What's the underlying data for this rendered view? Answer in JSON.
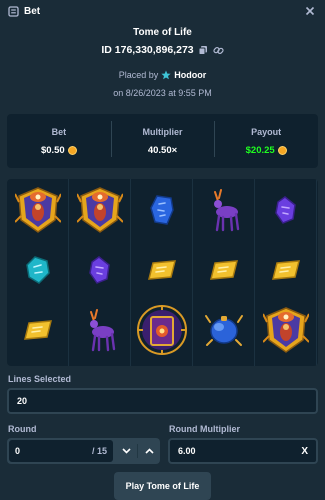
{
  "header": {
    "title": "Bet",
    "icon": "bet-slip-icon",
    "close_icon": "close-icon"
  },
  "bet": {
    "game": "Tome of Life",
    "id": "ID 176,330,896,273",
    "placed_by_label": "Placed by",
    "username": "Hodoor",
    "date": "on 8/26/2023 at 9:55 PM"
  },
  "stats": {
    "bet_label": "Bet",
    "bet_value": "$0.50",
    "multiplier_label": "Multiplier",
    "multiplier_value": "40.50×",
    "payout_label": "Payout",
    "payout_value": "$20.25"
  },
  "board": {
    "columns": 5,
    "rows": 3,
    "grid": [
      [
        "explorer-symbol",
        "explorer-symbol",
        "blue-gem-symbol",
        "purple-deer-symbol",
        "purple-gem-symbol"
      ],
      [
        "teal-gem-symbol",
        "purple-gem-symbol",
        "gold-ingot-symbol",
        "gold-ingot-symbol",
        "gold-ingot-symbol"
      ],
      [
        "gold-ingot-symbol",
        "purple-deer-symbol",
        "tome-scatter-symbol",
        "blue-scarab-symbol",
        "explorer-symbol"
      ]
    ]
  },
  "form": {
    "lines_label": "Lines Selected",
    "lines_value": "20",
    "round_label": "Round",
    "round_value": "0",
    "round_total": "/ 15",
    "round_multiplier_label": "Round Multiplier",
    "round_multiplier_value": "6.00",
    "clear_label": "X",
    "play_label": "Play Tome of Life"
  },
  "colors": {
    "background": "#1a2c38",
    "panel": "#0f212e",
    "payout": "#1fff20",
    "coin": "#f5a623",
    "accent": "#2f4553"
  }
}
